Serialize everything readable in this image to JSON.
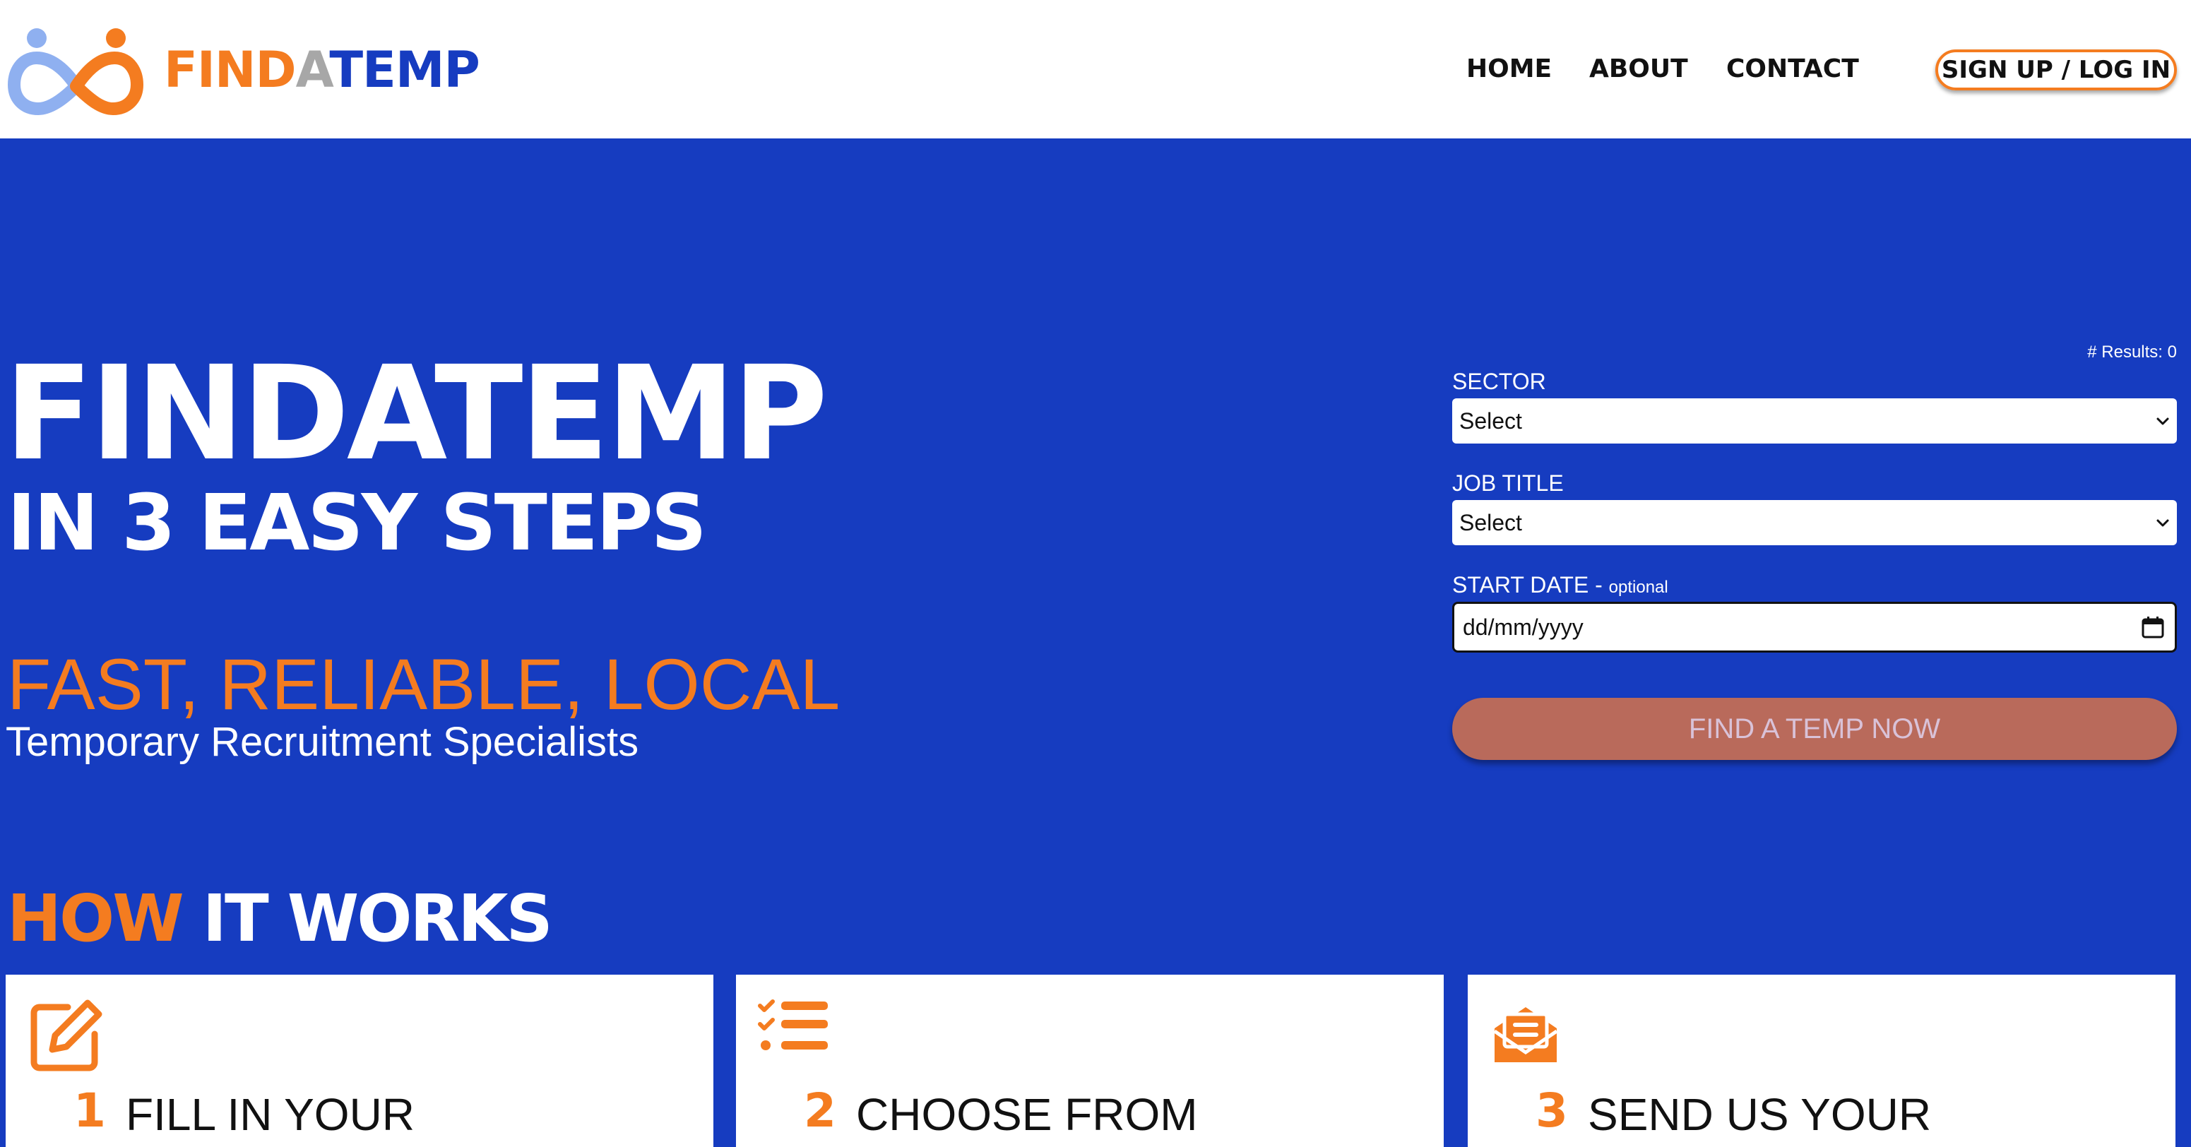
{
  "brand": {
    "part1": "FIND",
    "part2": "A",
    "part3": "TEMP",
    "colors": {
      "orange": "#f47c20",
      "blue": "#163cc0",
      "grey": "#a7a7a7",
      "light_blue": "#8fb0f0"
    },
    "logo_icon": "infinity-people-icon"
  },
  "nav": {
    "home": "HOME",
    "about": "ABOUT",
    "contact": "CONTACT",
    "signup": "SIGN UP / LOG IN"
  },
  "hero": {
    "title": "FINDATEMP",
    "subtitle": "IN 3 EASY STEPS",
    "tagline": "FAST, RELIABLE, LOCAL",
    "subtagline": "Temporary Recruitment Specialists"
  },
  "search": {
    "results": "# Results: 0",
    "sector_label": "SECTOR",
    "sector_value": "Select",
    "job_label": "JOB TITLE",
    "job_value": "Select",
    "date_label": "START DATE - ",
    "date_optional": "optional",
    "date_placeholder": "dd/mm/yyyy",
    "button": "FIND A TEMP NOW",
    "button_color": "#b96a5b"
  },
  "how": {
    "highlight": "HOW",
    "rest": " IT WORKS",
    "steps": [
      {
        "num": "1",
        "text": "FILL IN YOUR",
        "icon": "edit-icon"
      },
      {
        "num": "2",
        "text": "CHOOSE FROM",
        "icon": "checklist-icon"
      },
      {
        "num": "3",
        "text": "SEND US YOUR",
        "icon": "envelope-letter-icon"
      }
    ]
  }
}
